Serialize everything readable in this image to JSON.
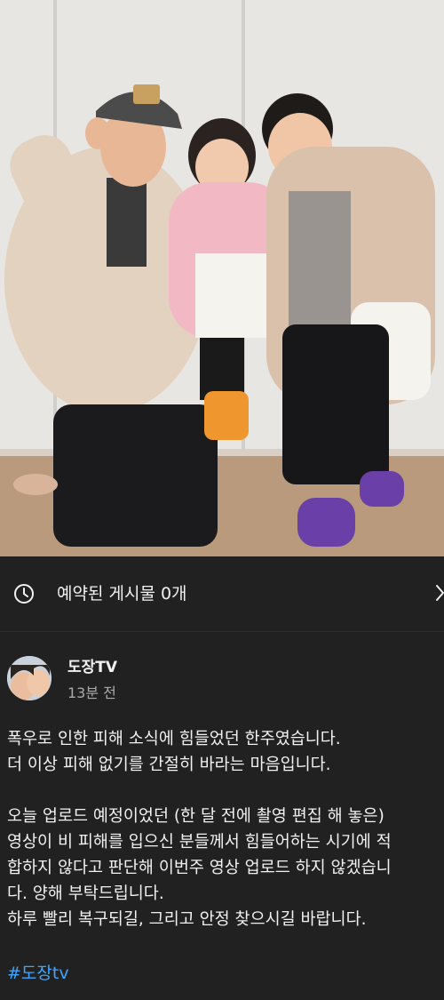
{
  "schedule": {
    "label": "예약된 게시물 0개",
    "icon": "clock-icon",
    "chevron_icon": "chevron-right-icon"
  },
  "post": {
    "channel_name": "도장TV",
    "time": "13분 전",
    "lines": [
      "폭우로 인한 피해 소식에 힘들었던 한주였습니다.",
      "더 이상 피해 없기를 간절히 바라는 마음입니다.",
      "오늘 업로드 예정이었던 (한 달 전에 촬영 편집 해 놓은)",
      "영상이  비 피해를 입으신 분들께서 힘들어하는 시기에 적",
      "합하지 않다고 판단해 이번주 영상 업로드 하지 않겠습니",
      "다. 양해 부탁드립니다.",
      "하루 빨리 복구되길, 그리고  안정 찾으시길 바랍니다."
    ],
    "hashtag": "#도장tv"
  },
  "colors": {
    "background": "#0f0f0f",
    "card": "#212121",
    "text": "#f1f1f1",
    "muted": "#aaaaaa",
    "link": "#3ea6ff"
  }
}
